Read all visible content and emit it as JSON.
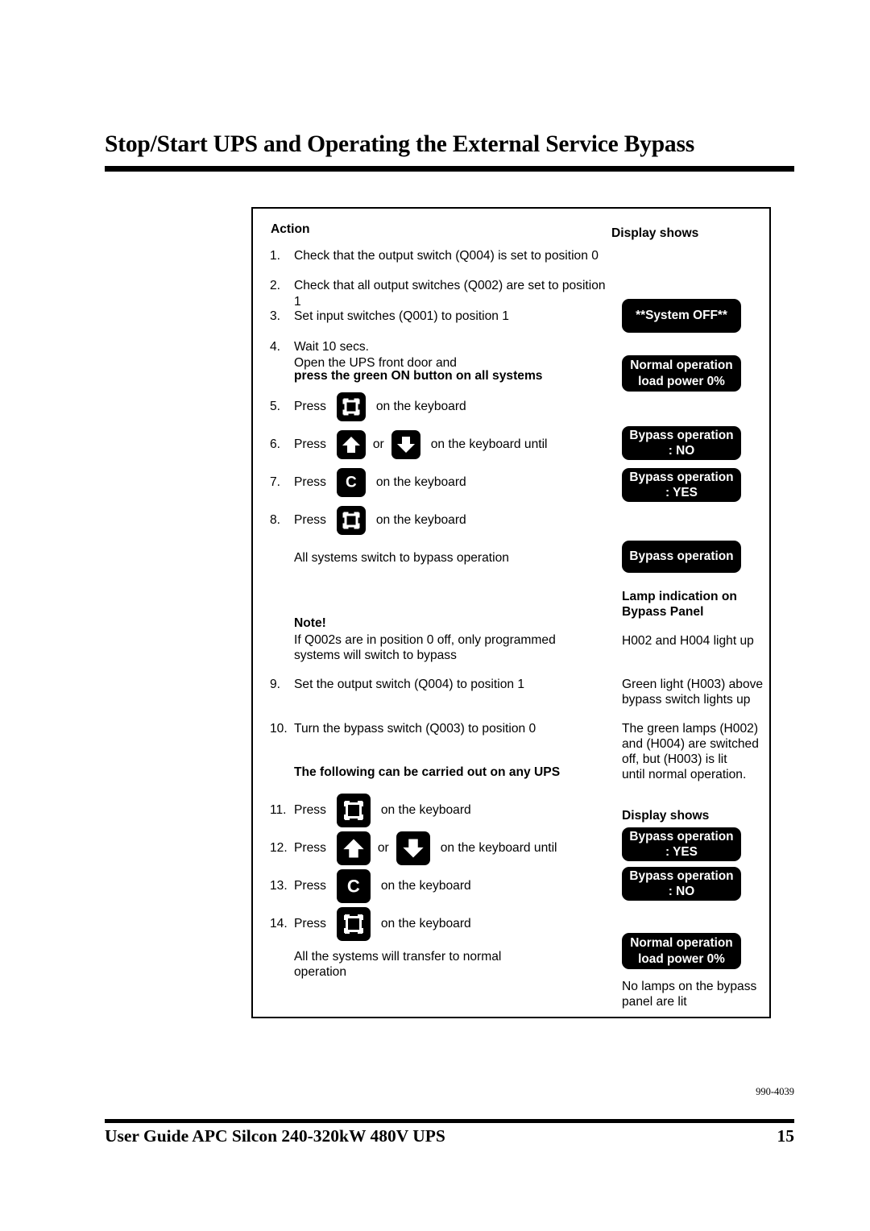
{
  "page": {
    "title": "Stop/Start UPS and Operating the External Service Bypass",
    "doc_code": "990-4039",
    "footer_title": "User Guide APC Silcon 240-320kW 480V UPS",
    "page_number": "15"
  },
  "table": {
    "headings": {
      "action": "Action",
      "display_shows_top": "Display shows",
      "lamp_indication": "Lamp indication on\nBypass Panel",
      "display_shows_bottom": "Display shows"
    },
    "steps": [
      {
        "num": "1.",
        "text": "Check that the output switch (Q004) is set to position 0"
      },
      {
        "num": "2.",
        "text": "Check that all output switches (Q002) are set to position 1"
      },
      {
        "num": "3.",
        "text": "Set input switches (Q001) to position 1"
      },
      {
        "num": "4.",
        "text": "Wait 10 secs.\nOpen the UPS front door and"
      }
    ],
    "step4_bold": "press the green ON button on all systems",
    "press_steps": [
      {
        "num": "5.",
        "press": "Press",
        "key": "menu-key",
        "suffix": "on the keyboard"
      },
      {
        "num": "6.",
        "press": "Press",
        "key": "up-arrow-key",
        "connector": "or",
        "key2": "down-arrow-key",
        "suffix": "on the keyboard until"
      },
      {
        "num": "7.",
        "press": "Press",
        "key": "c-key",
        "key_label": "C",
        "suffix": "on the keyboard"
      },
      {
        "num": "8.",
        "press": "Press",
        "key": "menu-key",
        "suffix": "on the keyboard"
      }
    ],
    "all_systems_bypass": "All systems switch to bypass operation",
    "note_label": "Note!",
    "note_text": "If Q002s are in position 0 off, only programmed\nsystems will switch to bypass",
    "step9": {
      "num": "9.",
      "text": "Set the output switch (Q004) to position 1"
    },
    "step10": {
      "num": "10.",
      "text": "Turn the bypass switch (Q003) to position 0"
    },
    "any_ups_heading": "The following can be carried out on any UPS",
    "press_steps_2": [
      {
        "num": "11.",
        "press": "Press",
        "key": "menu-key",
        "suffix": "on the keyboard"
      },
      {
        "num": "12.",
        "press": "Press",
        "key": "up-arrow-key",
        "connector": "or",
        "key2": "down-arrow-key",
        "suffix": "on the keyboard until"
      },
      {
        "num": "13.",
        "press": "Press",
        "key": "c-key",
        "key_label": "C",
        "suffix": "on the keyboard"
      },
      {
        "num": "14.",
        "press": "Press",
        "key": "menu-key",
        "suffix": "on the keyboard"
      }
    ],
    "transfer_normal": "All the systems will transfer to normal\noperation",
    "lamp_texts": {
      "h002_h004": "H002 and H004 light up",
      "h003_above": "Green light (H003) above\nbypass switch lights up",
      "green_lamps": "The green lamps (H002)\nand (H004) are switched\noff, but (H003) is lit\nuntil normal operation.",
      "no_lamps": "No lamps on the bypass\npanel are lit"
    },
    "displays": [
      {
        "id": "system-off",
        "text": "**System OFF**"
      },
      {
        "id": "normal-0",
        "text": "Normal operation\nload power 0%"
      },
      {
        "id": "bypass-no-1",
        "text": "Bypass operation\n: NO"
      },
      {
        "id": "bypass-yes-1",
        "text": "Bypass operation\n: YES"
      },
      {
        "id": "bypass-operation",
        "text": "Bypass operation"
      },
      {
        "id": "bypass-yes-2",
        "text": "Bypass operation\n: YES"
      },
      {
        "id": "bypass-no-2",
        "text": "Bypass operation\n: NO"
      },
      {
        "id": "normal-0-b",
        "text": "Normal operation\nload power 0%"
      }
    ]
  },
  "colors": {
    "ink": "#000000",
    "paper": "#ffffff",
    "lcd_background": "#000000",
    "lcd_text": "#ffffff"
  }
}
